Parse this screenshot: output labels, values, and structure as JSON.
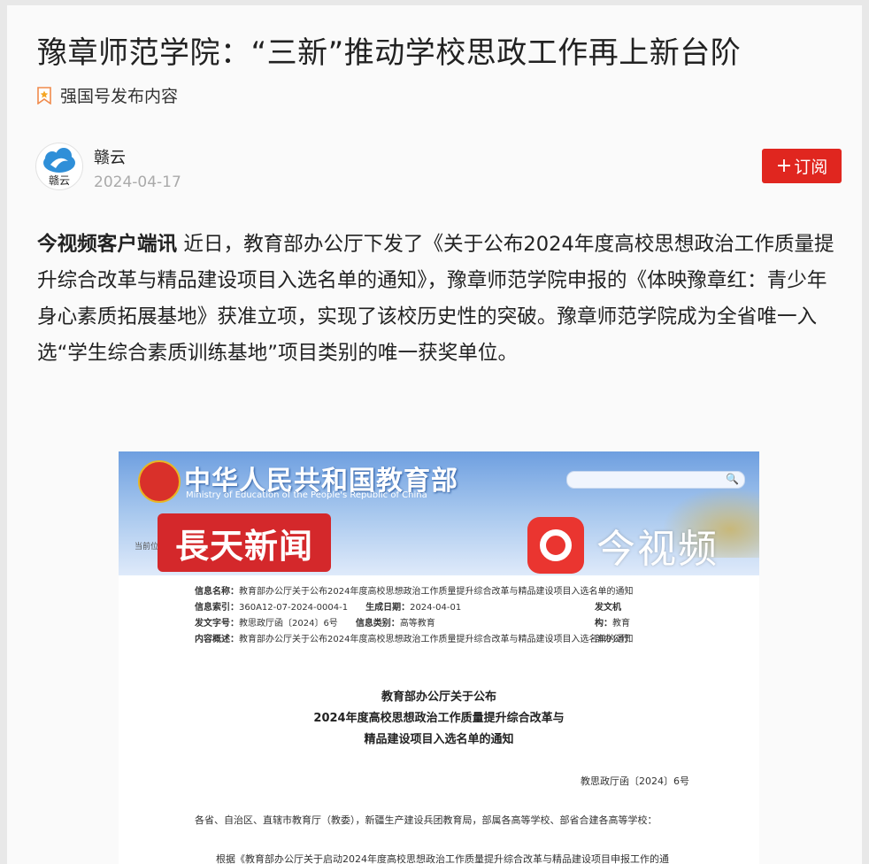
{
  "article": {
    "title": "豫章师范学院：“三新”推动学校思政工作再上新台阶",
    "source_label": "强国号发布内容",
    "author": {
      "name": "赣云",
      "date": "2024-04-17",
      "avatar_text": "赣云"
    },
    "subscribe_label": "订阅",
    "lead": "今视频客户端讯",
    "body": " 近日，教育部办公厅下发了《关于公布2024年度高校思想政治工作质量提升综合改革与精品建设项目入选名单的通知》，豫章师范学院申报的《体映豫章红：青少年身心素质拓展基地》获准立项，实现了该校历史性的突破。豫章师范学院成为全省唯一入选“学生综合素质训练基地”项目类别的唯一获奖单位。"
  },
  "image": {
    "header_cn": "中华人民共和国教育部",
    "header_en": "Ministry of Education of the People's Republic of China",
    "crumb": "当前位置",
    "watermark_left": "長天新闻",
    "watermark_right": "今视频",
    "meta": {
      "name_label": "信息名称：",
      "name_value": "教育部办公厅关于公布2024年度高校思想政治工作质量提升综合改革与精品建设项目入选名单的通知",
      "index_label": "信息索引：",
      "index_value": "360A12-07-2024-0004-1",
      "date_label": "生成日期：",
      "date_value": "2024-04-01",
      "org_label": "发文机构：",
      "org_value": "教育部办公厅",
      "docno_label": "发文字号：",
      "docno_value": "教思政厅函〔2024〕6号",
      "type_label": "信息类别：",
      "type_value": "高等教育",
      "summary_label": "内容概述：",
      "summary_value": "教育部办公厅关于公布2024年度高校思想政治工作质量提升综合改革与精品建设项目入选名单的通知"
    },
    "doc_title_1": "教育部办公厅关于公布",
    "doc_title_2": "2024年度高校思想政治工作质量提升综合改革与",
    "doc_title_3": "精品建设项目入选名单的通知",
    "doc_number": "教思政厅函〔2024〕6号",
    "doc_addressee": "各省、自治区、直辖市教育厅（教委），新疆生产建设兵团教育局，部属各高等学校、部省合建各高等学校：",
    "doc_para": "根据《教育部办公厅关于启动2024年度高校思想政治工作质量提升综合改革与精品建设项目申报工作的通"
  }
}
